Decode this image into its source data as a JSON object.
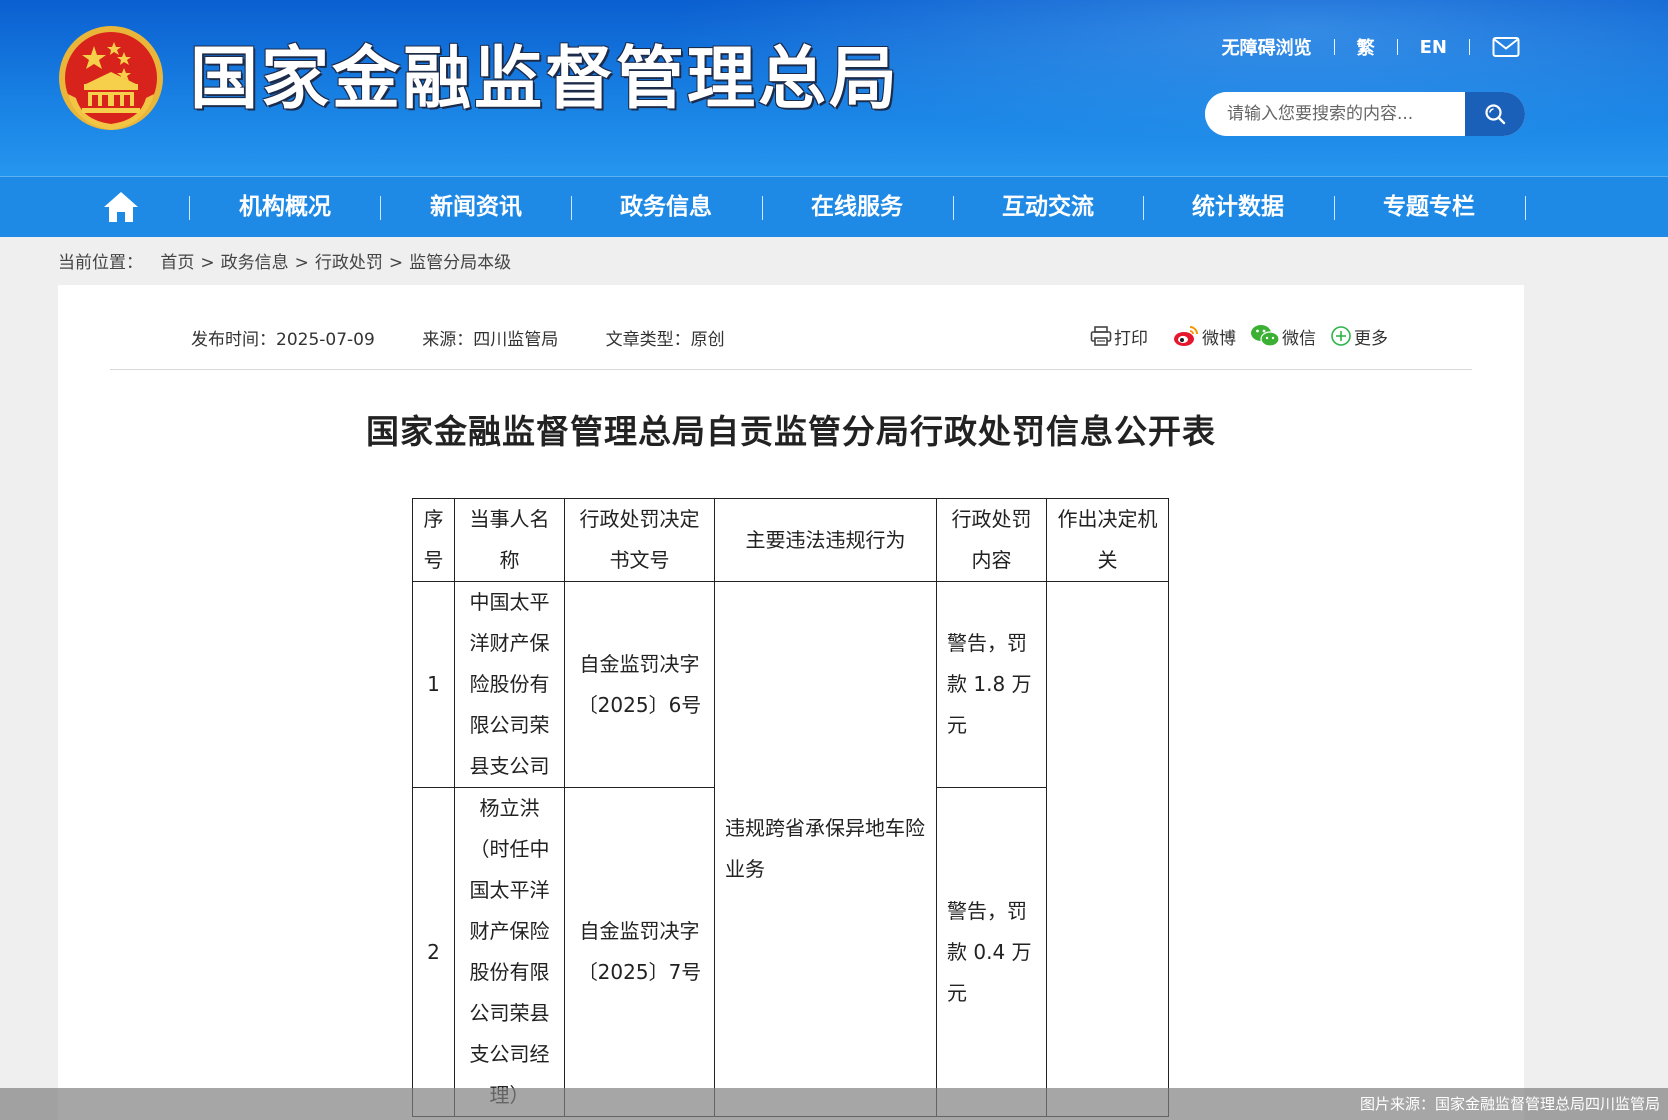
{
  "header": {
    "site_title": "国家金融监督管理总局",
    "top_links": [
      "无障碍浏览",
      "繁",
      "EN"
    ],
    "search": {
      "placeholder": "请输入您要搜索的内容..."
    },
    "icons": {
      "emblem": "national-emblem",
      "mail": "mail-icon",
      "search": "search-icon"
    }
  },
  "nav": {
    "items": [
      "机构概况",
      "新闻资讯",
      "政务信息",
      "在线服务",
      "互动交流",
      "统计数据",
      "专题专栏"
    ]
  },
  "breadcrumb": {
    "prefix": "当前位置：",
    "items": [
      "首页",
      "政务信息",
      "行政处罚",
      "监管分局本级"
    ],
    "separator": ">"
  },
  "article": {
    "meta": {
      "publish_label": "发布时间：",
      "publish_date": "2025-07-09",
      "source_label": "来源：",
      "source": "四川监管局",
      "type_label": "文章类型：",
      "type": "原创"
    },
    "share": {
      "print": "打印",
      "weibo": "微博",
      "wechat": "微信",
      "more": "更多"
    },
    "title": "国家金融监督管理总局自贡监管分局行政处罚信息公开表"
  },
  "table": {
    "headers": [
      "序号",
      "当事人名称",
      "行政处罚决定书文号",
      "主要违法违规行为",
      "行政处罚内容",
      "作出决定机关"
    ],
    "rows": [
      {
        "no": "1",
        "party": "中国太平洋财产保险股份有限公司荣县支公司",
        "doc_no": "自金监罚决字〔2025〕6号",
        "penalty": "警告，罚款 1.8 万元"
      },
      {
        "no": "2",
        "party": "杨立洪（时任中国太平洋财产保险股份有限公司荣县支公司经理）",
        "doc_no": "自金监罚决字〔2025〕7号",
        "penalty": "警告，罚款 0.4 万元"
      }
    ],
    "violation": "违规跨省承保异地车险业务",
    "authority": ""
  },
  "caption": "图片来源：国家金融监督管理总局四川监管局",
  "colors": {
    "header_blue": "#1880e3",
    "nav_blue": "#1f8ae6",
    "search_button": "#1a5fb8",
    "page_bg": "#efefef"
  }
}
